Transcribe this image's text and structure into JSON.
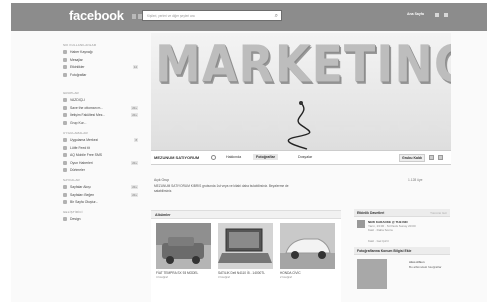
{
  "topbar": {
    "logo": "facebook",
    "search_placeholder": "Kişileri, yerleri ve diğer şeyleri ara",
    "user": "Ana Sayfa"
  },
  "sidebar": {
    "sections": [
      {
        "title": "SIK KULLANILANLAR",
        "items": [
          {
            "label": "Haber Kaynağı",
            "count": ""
          },
          {
            "label": "Mesajlar",
            "count": ""
          },
          {
            "label": "Etkinlikler",
            "count": "14"
          },
          {
            "label": "Fotoğraflar",
            "count": ""
          }
        ]
      },
      {
        "title": "GRUPLAR",
        "items": [
          {
            "label": "VAZDIÇLI",
            "count": ""
          },
          {
            "label": "Save the ottoman m...",
            "count": "20+"
          },
          {
            "label": "İletişim Fakültesi Mez...",
            "count": "20+"
          },
          {
            "label": "Grup Kur...",
            "count": ""
          }
        ]
      },
      {
        "title": "UYGULAMALAR",
        "items": [
          {
            "label": "Uygulama Merkezi",
            "count": "8"
          },
          {
            "label": "Lütfe Feed tit",
            "count": ""
          },
          {
            "label": "AQ Mobile Free SMS",
            "count": ""
          },
          {
            "label": "Oyun Haberleri",
            "count": "20+"
          },
          {
            "label": "Dürtmeler",
            "count": ""
          }
        ]
      },
      {
        "title": "SAYFALAR",
        "items": [
          {
            "label": "Sayfalar Akışı",
            "count": "20+"
          },
          {
            "label": "Sayfaları Beğen",
            "count": "20+"
          },
          {
            "label": "Bir Sayfa Oluştur...",
            "count": ""
          }
        ]
      },
      {
        "title": "GELİŞTİRİCİ",
        "items": [
          {
            "label": "Design",
            "count": ""
          }
        ]
      }
    ]
  },
  "cover": {
    "text": "MARKETING"
  },
  "namebar": {
    "page_name": "MEZUNUM SATIYORUM",
    "tabs": [
      "Hakkında",
      "Fotoğraflar",
      "Dosyalar"
    ],
    "group_settings": "Grubu Kaldı"
  },
  "info": {
    "privacy": "Açık Grup",
    "description": "MEZUNUM SATIYORUM KİBRIS grubunda 1st veya ve kitabi daha bulabilirsiniz. Beyalerme de satabilirsiniz.",
    "members": "1.128 üye"
  },
  "albums": {
    "title": "Albümler",
    "items": [
      {
        "label": "FİAT TEMPRA SX 93 MODEL",
        "count": "4 fotoğraf"
      },
      {
        "label": "SATILIK Dell N4110 İ5 - 14000TL",
        "count": "3 fotoğraf"
      },
      {
        "label": "HONDA CİVİC",
        "count": "2 fotoğraf"
      }
    ]
  },
  "right": {
    "events_title": "Etkinlik Davetleri",
    "events_more": "Tümünü Gör",
    "event_name": "NEW KARAOKE @ THE INN",
    "event_time": "Yarın, 23:00 · St Pauls Sunay 20:00",
    "event_action": "Katıl · Daha Sonra",
    "event_action2": "Katıl · Gel Çık'ir",
    "people_title": "Fotoğraflarına Konum Bilgisi Ekle",
    "person_name": "Ailos Albion",
    "person_text": "Bu albümdeki fotoğraflar"
  },
  "colors": {
    "topbar": "#8c8c8c",
    "cover_text": "#bdbdbd"
  }
}
